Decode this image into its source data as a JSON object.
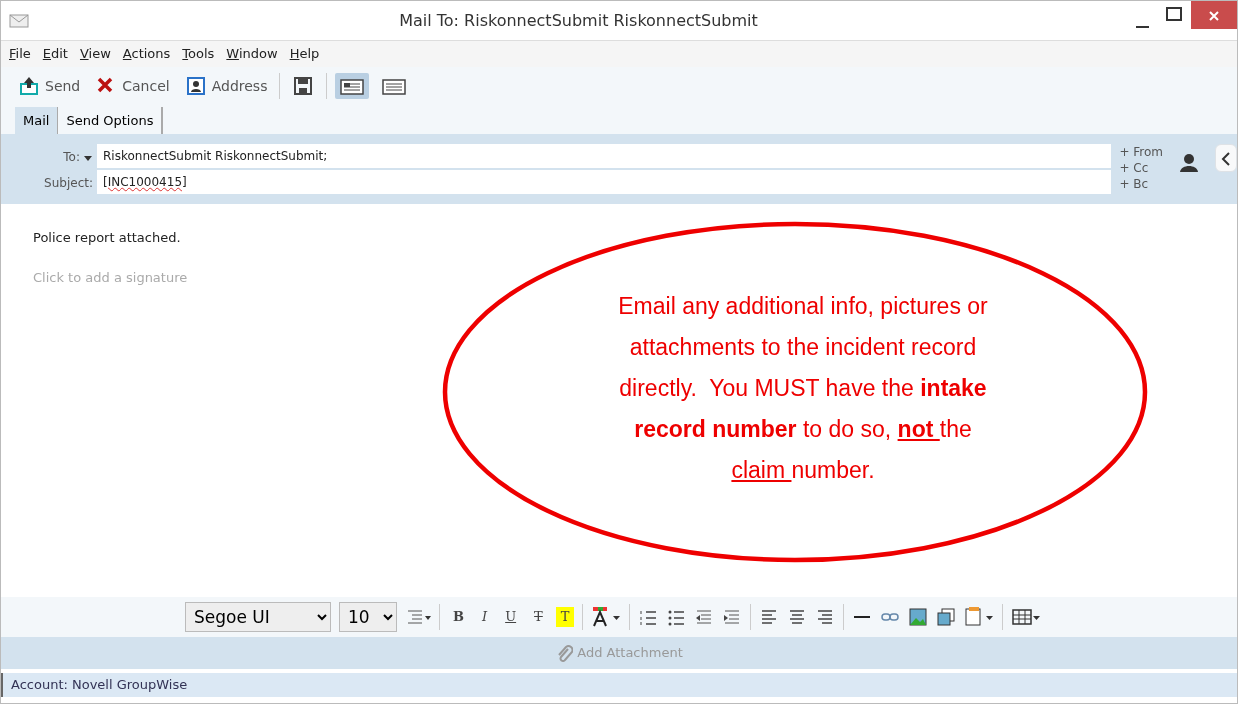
{
  "window": {
    "title": "Mail To: RiskonnectSubmit RiskonnectSubmit"
  },
  "menu": [
    "File",
    "Edit",
    "View",
    "Actions",
    "Tools",
    "Window",
    "Help"
  ],
  "toolbar": {
    "buttons": [
      {
        "kind": "send",
        "label": "Send"
      },
      {
        "kind": "cancel",
        "label": "Cancel"
      },
      {
        "kind": "address",
        "label": "Address"
      }
    ],
    "views": [
      {
        "selected": true
      },
      {
        "selected": false
      }
    ]
  },
  "tabs": [
    {
      "label": "Mail",
      "selected": true
    },
    {
      "label": "Send Options",
      "selected": false
    }
  ],
  "header": {
    "to_label": "To:",
    "to_value": "RiskonnectSubmit RiskonnectSubmit;",
    "subject_label": "Subject:",
    "subject_value": "[INC1000415]",
    "add_links": [
      "+ From",
      "+ Cc",
      "+ Bc"
    ]
  },
  "body": {
    "text": "Police report attached.",
    "signature_placeholder": "Click to add a signature"
  },
  "callout": {
    "segments": [
      {
        "text": "Email any additional info, pictures or attachments to the incident record directly.  You MUST have the ",
        "bold": false,
        "underline": false
      },
      {
        "text": "intake record number",
        "bold": true,
        "underline": false
      },
      {
        "text": " to do so, ",
        "bold": false,
        "underline": false
      },
      {
        "text": "not ",
        "bold": true,
        "underline": true
      },
      {
        "text": "the ",
        "bold": false,
        "underline": false
      },
      {
        "text": "claim ",
        "bold": false,
        "underline": true
      },
      {
        "text": "number.",
        "bold": false,
        "underline": false
      }
    ]
  },
  "format_bar": {
    "font": "Segoe UI",
    "size": "10",
    "letters": [
      {
        "kind": "bold",
        "label": "B"
      },
      {
        "kind": "italic",
        "label": "I"
      },
      {
        "kind": "underline",
        "label": "U"
      },
      {
        "kind": "strike",
        "label": "T"
      },
      {
        "kind": "highlight",
        "label": "T"
      }
    ]
  },
  "attachment": {
    "label": "Add Attachment"
  },
  "status_bar": {
    "text": "Account: Novell GroupWise"
  }
}
